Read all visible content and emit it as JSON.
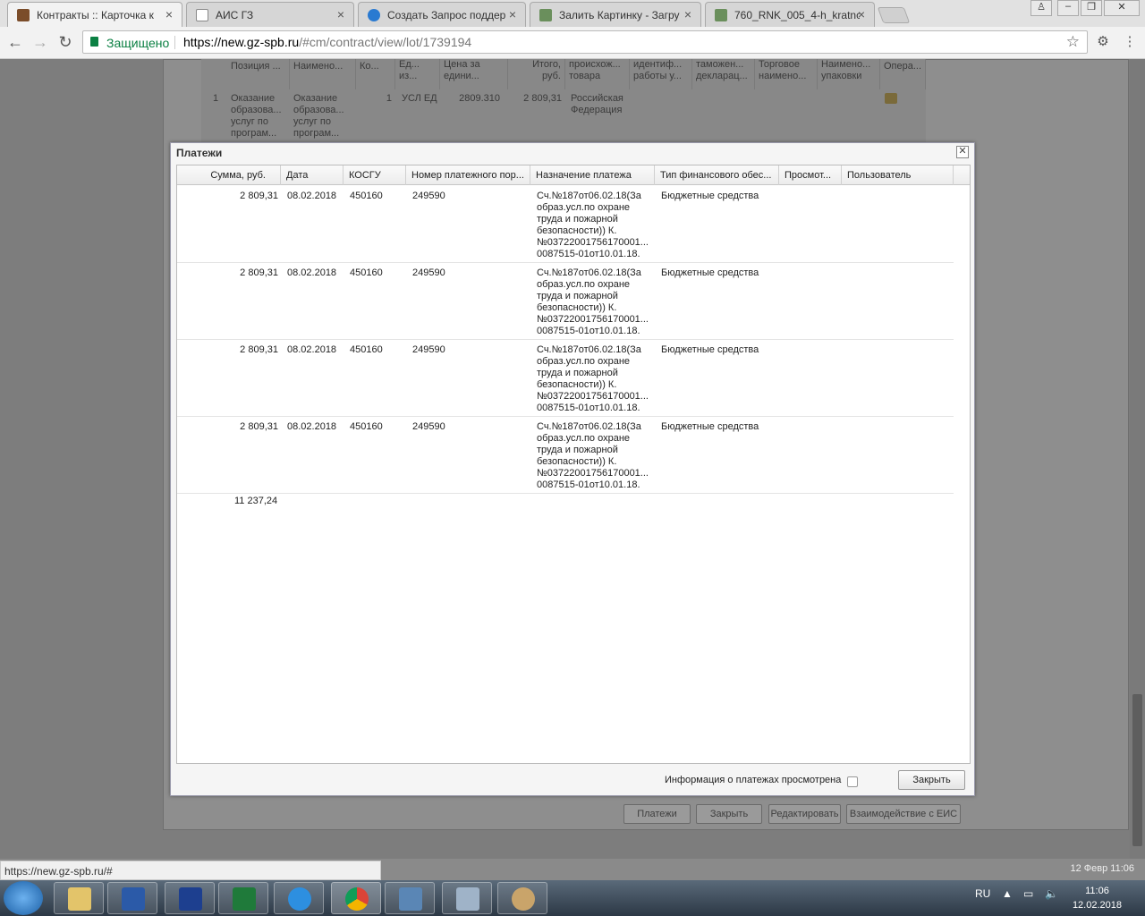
{
  "browser": {
    "tabs": [
      {
        "title": "Контракты :: Карточка к",
        "active": true
      },
      {
        "title": "АИС ГЗ",
        "active": false
      },
      {
        "title": "Создать Запрос поддер",
        "active": false
      },
      {
        "title": "Залить Картинку - Загру",
        "active": false
      },
      {
        "title": "760_RNK_005_4-h_kratnc",
        "active": false
      }
    ],
    "secure_label": "Защищено",
    "url_domain": "https://new.gz-spb.ru",
    "url_path": "/#cm/contract/view/lot/1739194",
    "status_url": "https://new.gz-spb.ru/#"
  },
  "background": {
    "headers": [
      "Позиция ...",
      "Наимено...",
      "Ко...",
      "Ед... из...",
      "Цена за едини...",
      "Итого, руб.",
      "происхож... товара",
      "идентиф... работы у...",
      "таможен... декларац...",
      "Торговое наимено...",
      "Наимено... упаковки",
      "Опера..."
    ],
    "row": {
      "num": "1",
      "position": "Оказание образова... услуг по програм...",
      "name": "Оказание образова... услуг по програм...",
      "qty": "1",
      "unit": "УСЛ ЕД",
      "price": "2809.310",
      "total": "2 809,31",
      "origin": "Российская Федерация"
    },
    "buttons": [
      "Платежи",
      "Закрыть",
      "Редактировать",
      "Взаимодействие с ЕИС"
    ]
  },
  "dialog": {
    "title": "Платежи",
    "columns": [
      "Сумма, руб.",
      "Дата",
      "КОСГУ",
      "Номер платежного пор...",
      "Назначение платежа",
      "Тип финансового обес...",
      "Просмот...",
      "Пользователь"
    ],
    "rows": [
      {
        "sum": "2 809,31",
        "date": "08.02.2018",
        "kosgu": "450160",
        "number": "249590",
        "purpose": [
          "Сч.№187от06.02.18(За",
          "образ.усл.по охране",
          "труда и пожарной",
          "безопасности)) К.",
          "№03722001756170001...",
          "0087515-01от10.01.18."
        ],
        "fin_type": "Бюджетные средства"
      },
      {
        "sum": "2 809,31",
        "date": "08.02.2018",
        "kosgu": "450160",
        "number": "249590",
        "purpose": [
          "Сч.№187от06.02.18(За",
          "образ.усл.по охране",
          "труда и пожарной",
          "безопасности)) К.",
          "№03722001756170001...",
          "0087515-01от10.01.18."
        ],
        "fin_type": "Бюджетные средства"
      },
      {
        "sum": "2 809,31",
        "date": "08.02.2018",
        "kosgu": "450160",
        "number": "249590",
        "purpose": [
          "Сч.№187от06.02.18(За",
          "образ.усл.по охране",
          "труда и пожарной",
          "безопасности)) К.",
          "№03722001756170001...",
          "0087515-01от10.01.18."
        ],
        "fin_type": "Бюджетные средства"
      },
      {
        "sum": "2 809,31",
        "date": "08.02.2018",
        "kosgu": "450160",
        "number": "249590",
        "purpose": [
          "Сч.№187от06.02.18(За",
          "образ.усл.по охране",
          "труда и пожарной",
          "безопасности)) К.",
          "№03722001756170001...",
          "0087515-01от10.01.18."
        ],
        "fin_type": "Бюджетные средства"
      }
    ],
    "total": "11 237,24",
    "viewed_label": "Информация о платежах просмотрена",
    "close_label": "Закрыть"
  },
  "status_date": "12 Февр 11:06",
  "taskbar": {
    "lang": "RU",
    "time": "11:06",
    "date": "12.02.2018"
  }
}
